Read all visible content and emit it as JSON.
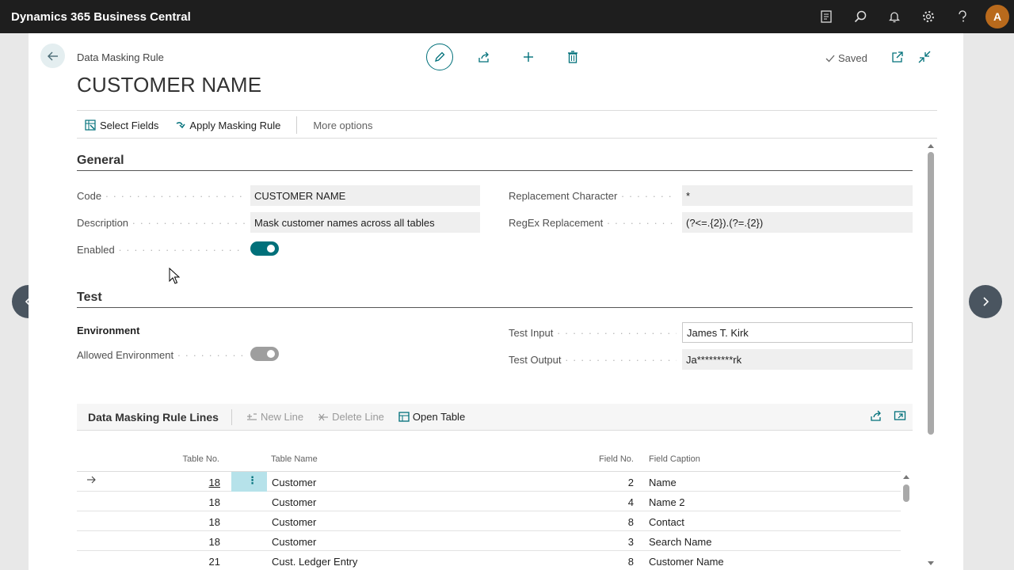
{
  "app": {
    "title": "Dynamics 365 Business Central",
    "avatar_initial": "A"
  },
  "header": {
    "breadcrumb": "Data Masking Rule",
    "title": "CUSTOMER NAME",
    "status": "Saved"
  },
  "actionbar": {
    "select_fields": "Select Fields",
    "apply_masking_rule": "Apply Masking Rule",
    "more_options": "More options"
  },
  "general": {
    "heading": "General",
    "code_label": "Code",
    "code_value": "CUSTOMER NAME",
    "description_label": "Description",
    "description_value": "Mask customer names across all tables",
    "enabled_label": "Enabled",
    "enabled": true,
    "replacement_char_label": "Replacement Character",
    "replacement_char_value": "*",
    "regex_label": "RegEx Replacement",
    "regex_value": "(?<=.{2}).(?=.{2})"
  },
  "test": {
    "heading": "Test",
    "environment_heading": "Environment",
    "allowed_env_label": "Allowed Environment",
    "allowed_env": false,
    "input_label": "Test Input",
    "input_value": "James T. Kirk",
    "output_label": "Test Output",
    "output_value": "Ja*********rk"
  },
  "lines": {
    "title": "Data Masking Rule Lines",
    "new_line": "New Line",
    "delete_line": "Delete Line",
    "open_table": "Open Table",
    "columns": {
      "table_no": "Table No.",
      "table_name": "Table Name",
      "field_no": "Field No.",
      "field_caption": "Field Caption"
    },
    "rows": [
      {
        "table_no": "18",
        "table_name": "Customer",
        "field_no": "2",
        "field_caption": "Name"
      },
      {
        "table_no": "18",
        "table_name": "Customer",
        "field_no": "4",
        "field_caption": "Name 2"
      },
      {
        "table_no": "18",
        "table_name": "Customer",
        "field_no": "8",
        "field_caption": "Contact"
      },
      {
        "table_no": "18",
        "table_name": "Customer",
        "field_no": "3",
        "field_caption": "Search Name"
      },
      {
        "table_no": "21",
        "table_name": "Cust. Ledger Entry",
        "field_no": "8",
        "field_caption": "Customer Name"
      }
    ]
  },
  "colors": {
    "accent": "#00707a",
    "topbar": "#1e1e1e",
    "avatar": "#b96a1c"
  }
}
